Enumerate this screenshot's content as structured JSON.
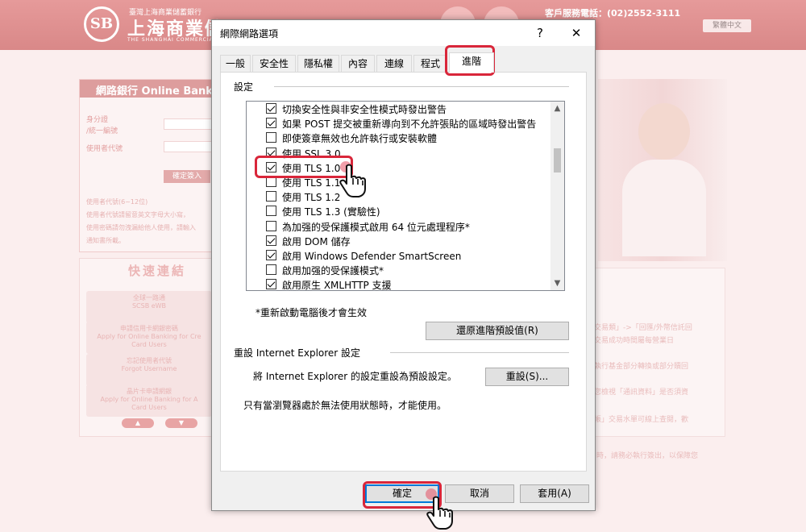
{
  "background": {
    "logo_mark": "SB",
    "logo_small": "臺灣上海商業儲蓄銀行",
    "logo_name": "上海商業儲",
    "logo_en": "THE SHANGHAI COMMERCIAL & S",
    "service": "客戶服務電話：(02)2552-3111",
    "lang_select": "繁體中文",
    "login": {
      "title": "網路銀行 Online Bank",
      "id_label": "身分證",
      "id_label2": "/統一編號",
      "user_label": "使用者代號",
      "login_button": "確定簽入",
      "notes": [
        "使用者代號(6~12位)",
        "使用者代號請留意英文字母大小寫，",
        "使用密碼請勿洩漏給他人使用，請輸入",
        "通知書所載。"
      ]
    },
    "quick": {
      "title": "快速連結",
      "buttons": [
        {
          "zh": "全球一路通",
          "en": "SCSB eWB"
        },
        {
          "zh": "申請信用卡網銀密碼",
          "en": "Apply for Online Banking for Cre",
          "en2": "Card Users"
        },
        {
          "zh": "忘記使用者代號",
          "en": "Forgot Username"
        },
        {
          "zh": "晶片卡申請網銀",
          "en": "Apply for Online Banking for A",
          "en2": "Card Users"
        }
      ],
      "up_arrow": "▲",
      "down_arrow": "▼"
    },
    "news_lines": [
      "交易類」->「回匯/外幣信託回",
      "交易成功時間屬每營業日",
      "執行基金部分轉換或部分贖回",
      "您檢視「通訊資料」是否須資",
      "帳」交易水單可線上查閱，歡",
      "時，請務必執行簽出，以保障您"
    ]
  },
  "dialog": {
    "title": "網際網路選項",
    "help_button": "?",
    "close_button": "✕",
    "tabs": [
      {
        "label": "一般",
        "active": false
      },
      {
        "label": "安全性",
        "active": false
      },
      {
        "label": "隱私權",
        "active": false
      },
      {
        "label": "內容",
        "active": false
      },
      {
        "label": "連線",
        "active": false
      },
      {
        "label": "程式",
        "active": false
      },
      {
        "label": "進階",
        "active": true
      }
    ],
    "settings_label": "設定",
    "options": [
      {
        "label": "切換安全性與非安全性模式時發出警告",
        "checked": true
      },
      {
        "label": "如果 POST 提交被重新導向到不允許張貼的區域時發出警告",
        "checked": true
      },
      {
        "label": "即使簽章無效也允許執行或安裝軟體",
        "checked": false
      },
      {
        "label": "使用 SSL 3.0",
        "checked": true
      },
      {
        "label": "使用 TLS 1.0",
        "checked": true
      },
      {
        "label": "使用 TLS 1.1",
        "checked": false
      },
      {
        "label": "使用 TLS 1.2",
        "checked": false
      },
      {
        "label": "使用 TLS 1.3 (實驗性)",
        "checked": false
      },
      {
        "label": "為加强的受保護模式啟用 64 位元處理程序*",
        "checked": false
      },
      {
        "label": "啟用 DOM 儲存",
        "checked": true
      },
      {
        "label": "啟用 Windows Defender SmartScreen",
        "checked": true
      },
      {
        "label": "啟用加强的受保護模式*",
        "checked": false
      },
      {
        "label": "啟用原生 XMLHTTP 支援",
        "checked": true
      }
    ],
    "scroll_up": "▲",
    "scroll_down": "▼",
    "restart_note": "*重新啟動電腦後才會生效",
    "restore_button": "還原進階預設值(R)",
    "reset_section_label": "重設 Internet Explorer 設定",
    "reset_description": "將 Internet Explorer 的設定重設為預設設定。",
    "reset_button": "重設(S)...",
    "reset_note": "只有當瀏覽器處於無法使用狀態時，才能使用。",
    "ok_button": "確定",
    "cancel_button": "取消",
    "apply_button": "套用(A)"
  },
  "colors": {
    "highlight": "#d9263a",
    "dialog_bg": "#f0f0f0",
    "bank_pink": "#d98888"
  }
}
